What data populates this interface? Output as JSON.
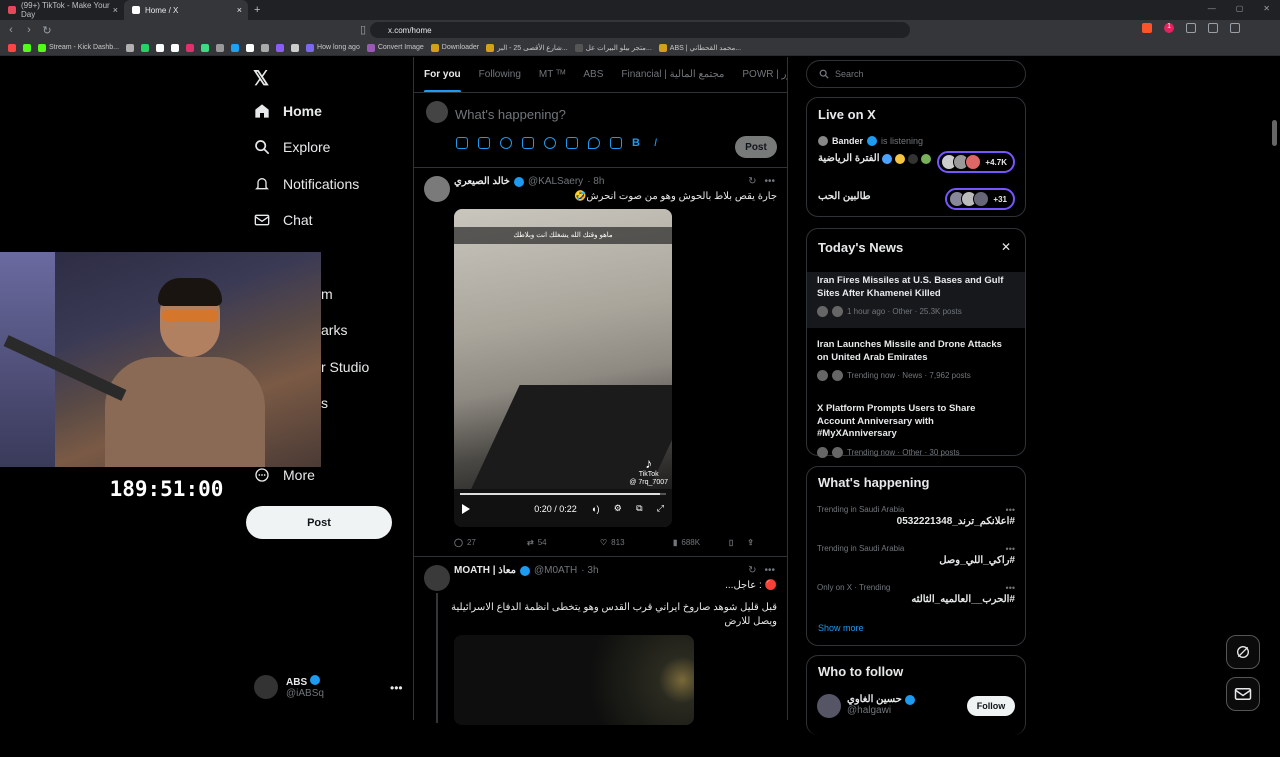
{
  "browser": {
    "tabs": [
      {
        "label": "(99+) TikTok - Make Your Day",
        "active": false,
        "color": "#e8465a"
      },
      {
        "label": "Home / X",
        "active": true,
        "color": "#ffffff"
      }
    ],
    "url": "x.com/home",
    "notification_count": "1",
    "bookmarks": [
      "",
      "",
      "Stream - Kick Dashb...",
      "",
      "",
      "",
      "",
      "",
      "",
      "",
      "",
      "",
      "",
      "",
      "",
      "How long ago",
      "Convert Image",
      "Downloader",
      "شارع الأقصى 25 - البر...",
      "متجر بيلو البيرات عل...",
      "ABS | محمد القحطاني..."
    ]
  },
  "nav": {
    "items": [
      {
        "label": "Home",
        "icon": "home-icon"
      },
      {
        "label": "Explore",
        "icon": "search-icon"
      },
      {
        "label": "Notifications",
        "icon": "bell-icon"
      },
      {
        "label": "Chat",
        "icon": "mail-icon"
      }
    ],
    "hidden_fragments": [
      "m",
      "arks",
      "r Studio",
      "s"
    ],
    "more_label": "More",
    "post_label": "Post",
    "account": {
      "name": "ABS",
      "handle": "@iABSq"
    }
  },
  "stream": {
    "timer": "189:51:00"
  },
  "feed": {
    "tabs": [
      "For you",
      "Following",
      "MT ᵀᴹ",
      "ABS",
      "Financial | مجتمع المالية",
      "POWR | ور"
    ],
    "compose_placeholder": "What's happening?",
    "compose_post": "Post",
    "tweets": [
      {
        "name": "خالد الصيعري",
        "handle": "@KALSaery",
        "time": "· 8h",
        "text": "جارة يقص بلاط بالحوش وهو من صوت انحرش🤣",
        "video_caption": "ماهو وقتك الله يشغلك انت وبلاطك",
        "tiktok_label": "TikTok",
        "tiktok_user": "@ 7rq_7007",
        "video_time": "0:20 / 0:22",
        "video_progress": 0.97,
        "replies": "27",
        "reposts": "54",
        "likes": "813",
        "views": "688K"
      },
      {
        "name": "MOATH | معاذ",
        "handle": "@M0ATH",
        "time": "· 3h",
        "line1": "🔴 : عاجل...",
        "text": "قبل قليل شوهد صاروخ ايراني قرب القدس وهو يتخطى انظمة الدفاع الاسرائيلية ويصل للارض"
      }
    ]
  },
  "sidebar": {
    "search_placeholder": "Search",
    "live": {
      "title": "Live on X",
      "listener": "Bander",
      "listening": "is listening",
      "space1": "الفترة الرياضية",
      "space1_count": "+4.7K",
      "space2": "طالبين الحب",
      "space2_count": "+31"
    },
    "news": {
      "title": "Today's News",
      "items": [
        {
          "title": "Iran Fires Missiles at U.S. Bases and Gulf Sites After Khamenei Killed",
          "meta": "1 hour ago · Other · 25.3K posts"
        },
        {
          "title": "Iran Launches Missile and Drone Attacks on United Arab Emirates",
          "meta": "Trending now · News · 7,962 posts"
        },
        {
          "title": "X Platform Prompts Users to Share Account Anniversary with #MyXAnniversary",
          "meta": "Trending now · Other · 30 posts"
        }
      ]
    },
    "happening": {
      "title": "What's happening",
      "trends": [
        {
          "context": "Trending in Saudi Arabia",
          "tag": "#اعلانكم_ترند_0532221348"
        },
        {
          "context": "Trending in Saudi Arabia",
          "tag": "#راكي_اللي_وصل"
        },
        {
          "context": "Only on X · Trending",
          "tag": "#الحرب__العالميه_الثالثه"
        }
      ],
      "show_more": "Show more"
    },
    "follow": {
      "title": "Who to follow",
      "name": "حسين الغاوي",
      "handle": "@halgawi",
      "button": "Follow"
    }
  },
  "colors": {
    "accent": "#1d9bf0",
    "live": "#7856ff",
    "bg": "#000000"
  }
}
